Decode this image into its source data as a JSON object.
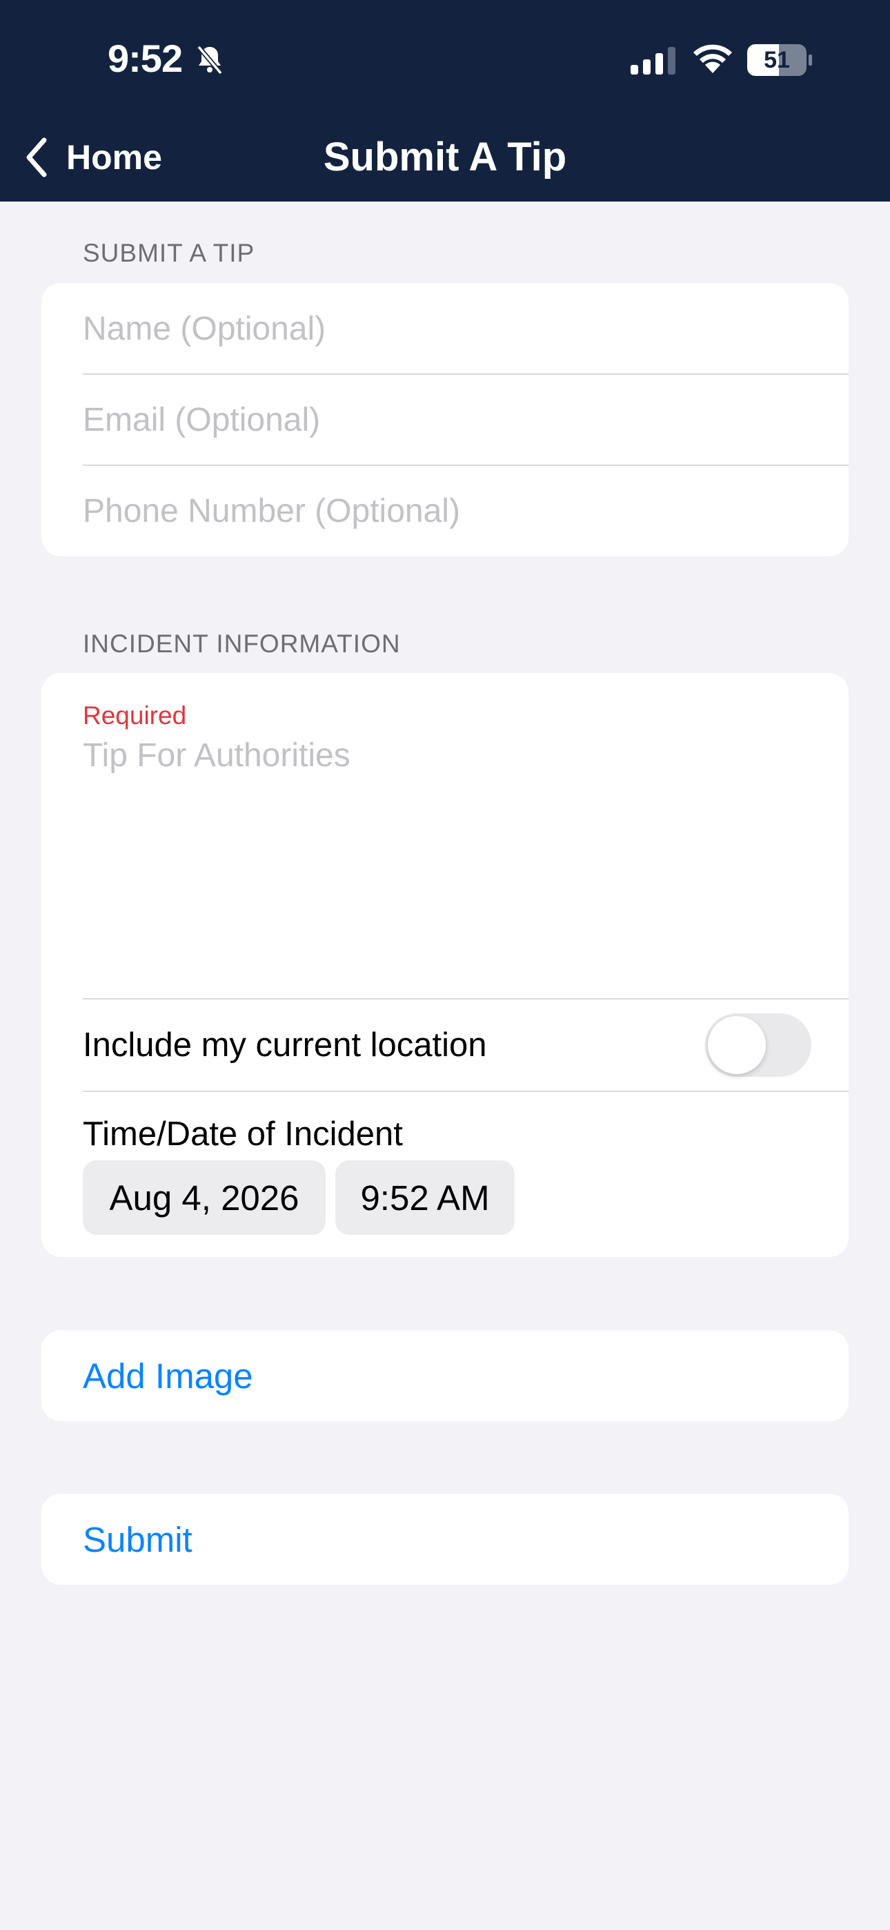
{
  "status_bar": {
    "time": "9:52",
    "battery": "51"
  },
  "nav": {
    "back_label": "Home",
    "title": "Submit A Tip"
  },
  "contact_section": {
    "header": "SUBMIT A TIP",
    "name_placeholder": "Name (Optional)",
    "email_placeholder": "Email (Optional)",
    "phone_placeholder": "Phone Number (Optional)"
  },
  "incident_section": {
    "header": "INCIDENT INFORMATION",
    "required_label": "Required",
    "tip_placeholder": "Tip For Authorities",
    "location_label": "Include my current location",
    "location_enabled": false,
    "datetime_label": "Time/Date of Incident",
    "date_value": "Aug 4, 2026",
    "time_value": "9:52 AM"
  },
  "actions": {
    "add_image_label": "Add Image",
    "submit_label": "Submit"
  },
  "colors": {
    "nav_background": "#13233f",
    "page_background": "#f2f2f7",
    "link": "#0a84ff",
    "required": "#e0363e"
  }
}
